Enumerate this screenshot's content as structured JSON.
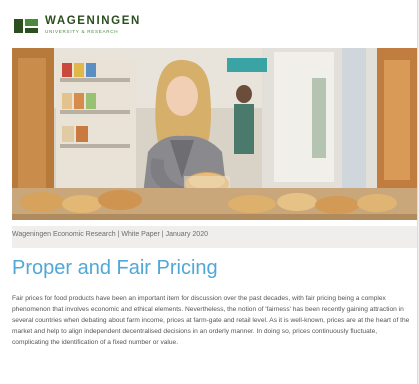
{
  "brand": {
    "name": "WAGENINGEN",
    "subtitle": "UNIVERSITY & RESEARCH",
    "logo_color": "#2c4f1f",
    "accent_color": "#4a8a3c"
  },
  "document": {
    "meta_line": "Wageningen Economic Research | White Paper | January 2020",
    "title": "Proper and Fair Pricing",
    "title_color": "#4fa8d8",
    "body": "Fair prices for food products have been an important item for discussion over the past decades, with fair pricing being a complex phenomenon that involves economic and ethical elements. Nevertheless, the notion of 'fairness' has been recently gaining attraction in several countries when debating about farm income, prices at farm-gate and retail level. As it is well-known, prices are at the heart of the market and help to align independent decentralised decisions in an orderly manner. In doing so, prices continuously fluctuate, complicating the identification of a fixed number or value."
  }
}
